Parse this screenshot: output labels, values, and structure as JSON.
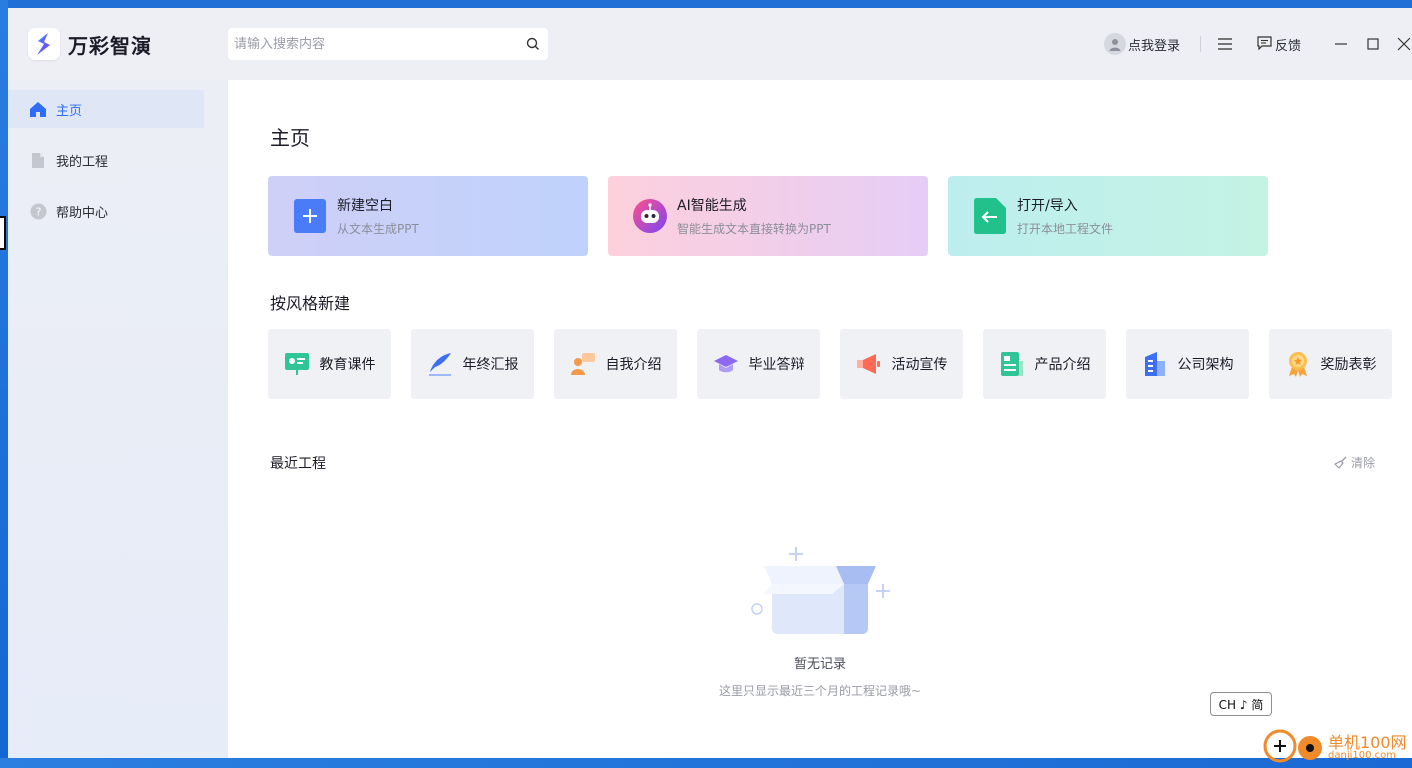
{
  "app": {
    "name": "万彩智演",
    "brand_color": "#2f6df4"
  },
  "search": {
    "placeholder": "请输入搜索内容"
  },
  "header": {
    "login_label": "点我登录",
    "feedback_label": "反馈"
  },
  "sidebar": {
    "items": [
      {
        "label": "主页",
        "icon": "home-icon",
        "active": true
      },
      {
        "label": "我的工程",
        "icon": "file-icon",
        "active": false
      },
      {
        "label": "帮助中心",
        "icon": "help-icon",
        "active": false
      }
    ]
  },
  "main": {
    "title": "主页",
    "quick_cards": [
      {
        "title": "新建空白",
        "subtitle": "从文本生成PPT",
        "icon": "plus-icon"
      },
      {
        "title": "AI智能生成",
        "subtitle": "智能生成文本直接转换为PPT",
        "icon": "robot-icon"
      },
      {
        "title": "打开/导入",
        "subtitle": "打开本地工程文件",
        "icon": "import-icon"
      }
    ],
    "style_section_title": "按风格新建",
    "styles": [
      {
        "label": "教育课件",
        "icon": "presentation-board-icon"
      },
      {
        "label": "年终汇报",
        "icon": "feather-pen-icon"
      },
      {
        "label": "自我介绍",
        "icon": "person-chat-icon"
      },
      {
        "label": "毕业答辩",
        "icon": "graduation-cap-icon"
      },
      {
        "label": "活动宣传",
        "icon": "megaphone-icon"
      },
      {
        "label": "产品介绍",
        "icon": "document-icon"
      },
      {
        "label": "公司架构",
        "icon": "building-icon"
      },
      {
        "label": "奖励表彰",
        "icon": "medal-icon"
      }
    ],
    "recent": {
      "title": "最近工程",
      "clear_label": "清除",
      "empty_title": "暂无记录",
      "empty_subtitle": "这里只显示最近三个月的工程记录哦~"
    }
  },
  "system": {
    "ime_label": "CH ♪ 简"
  },
  "watermark": {
    "site_name": "单机100网",
    "site_url": "danji100.com"
  }
}
